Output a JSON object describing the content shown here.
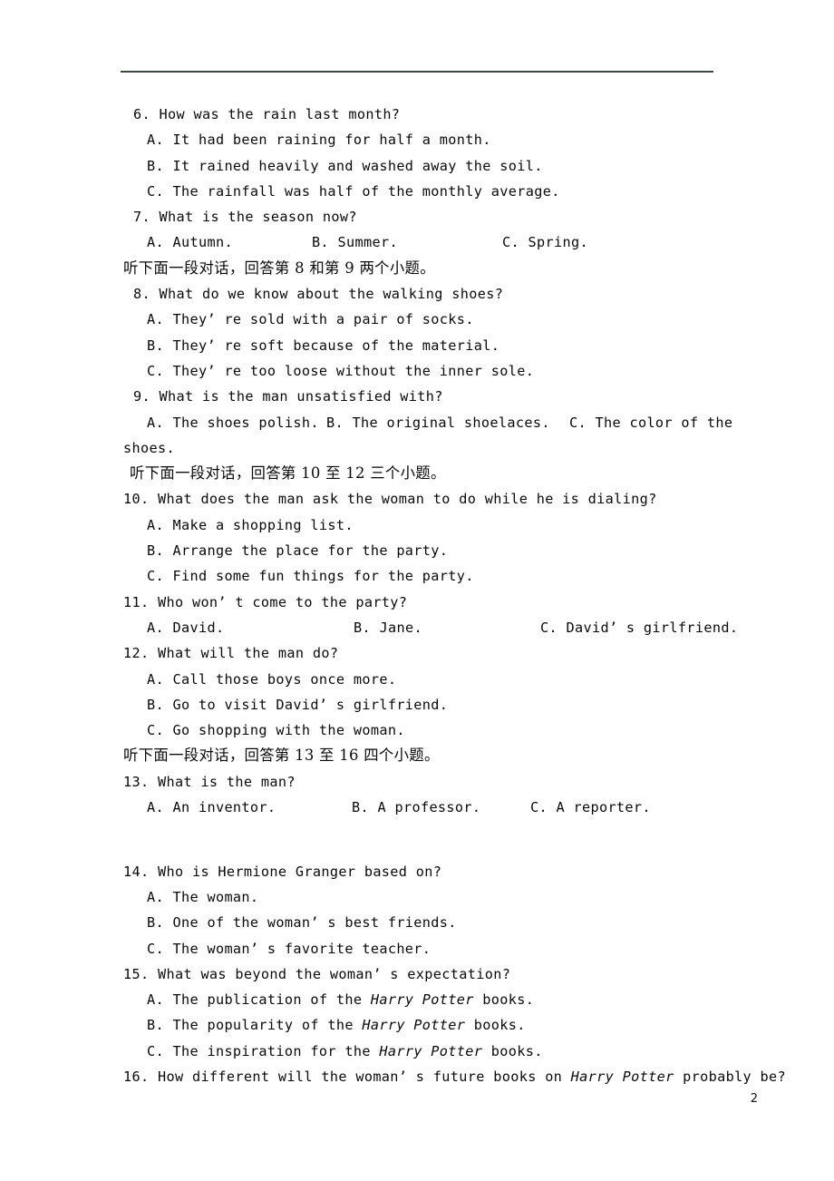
{
  "document": {
    "page_number": "2",
    "rule_color": "#3d4a3d"
  },
  "questions": [
    {
      "number": "6.",
      "stem": "6.  How was the rain last month?",
      "options_block": [
        "A.  It had been raining for half a month.",
        "B.  It rained heavily and washed away the soil.",
        "C.  The rainfall was half of the monthly average."
      ]
    },
    {
      "number": "7.",
      "stem": "7.  What is the season now?",
      "columns": {
        "a": "A.  Autumn.",
        "b": "B.  Summer.",
        "c": "C.  Spring."
      }
    },
    {
      "number": "8.",
      "stem": "8.  What do we know about the walking shoes?",
      "options_block": [
        "A.  They’ re sold with a pair of socks.",
        "B.  They’ re soft because of the material.",
        "C.  They’ re too loose without the inner sole."
      ]
    },
    {
      "number": "9.",
      "stem": "9.  What is the man unsatisfied with?",
      "columns": {
        "a": "A.  The shoes polish.",
        "b": "B.  The original shoelaces.",
        "c": "C.  The color of the"
      },
      "wrap": "shoes."
    },
    {
      "number": "10.",
      "stem": "10.  What does the man ask the woman to do while he is dialing?",
      "options_block": [
        "A.  Make a shopping list.",
        "B.  Arrange the place for the party.",
        "C.  Find some fun things for the party."
      ]
    },
    {
      "number": "11.",
      "stem": "11.  Who won’ t come to the party?",
      "columns": {
        "a": "A.  David.",
        "b": "B.  Jane.",
        "c": "C.  David’ s girlfriend."
      }
    },
    {
      "number": "12.",
      "stem": "12.  What will the man do?",
      "options_block": [
        "A.  Call those boys once more.",
        "B.  Go to visit David’ s girlfriend.",
        "C.  Go shopping with the woman."
      ]
    },
    {
      "number": "13.",
      "stem": "13.  What is the man?",
      "columns": {
        "a": "A.  An inventor.",
        "b": "B.  A professor.",
        "c": "C.  A reporter."
      }
    },
    {
      "number": "14.",
      "stem": "14.  Who is Hermione Granger based on?",
      "options_block": [
        "A.  The woman.",
        "B.  One of the woman’ s best friends.",
        "C.  The woman’ s favorite teacher."
      ]
    },
    {
      "number": "15.",
      "stem": "15.  What was beyond the woman’ s expectation?",
      "options_italic": [
        {
          "pre": "A.  The publication of the ",
          "title": "Harry Potter",
          "post": " books."
        },
        {
          "pre": "B.  The popularity of the ",
          "title": "Harry Potter",
          "post": " books."
        },
        {
          "pre": "C.  The inspiration for the ",
          "title": "Harry Potter",
          "post": " books."
        }
      ]
    },
    {
      "number": "16.",
      "stem_parts": {
        "pre": "16.  How different will the woman’ s future books on ",
        "title": "Harry Potter",
        "post": " probably be?"
      }
    }
  ],
  "instructions": [
    {
      "id": "ins-8-9",
      "text": "听下面一段对话，回答第 8 和第 9 两个小题。"
    },
    {
      "id": "ins-10-12",
      "text": "听下面一段对话，回答第 10 至 12 三个小题。"
    },
    {
      "id": "ins-13-16",
      "text": "听下面一段对话，回答第 13 至 16 四个小题。"
    }
  ]
}
